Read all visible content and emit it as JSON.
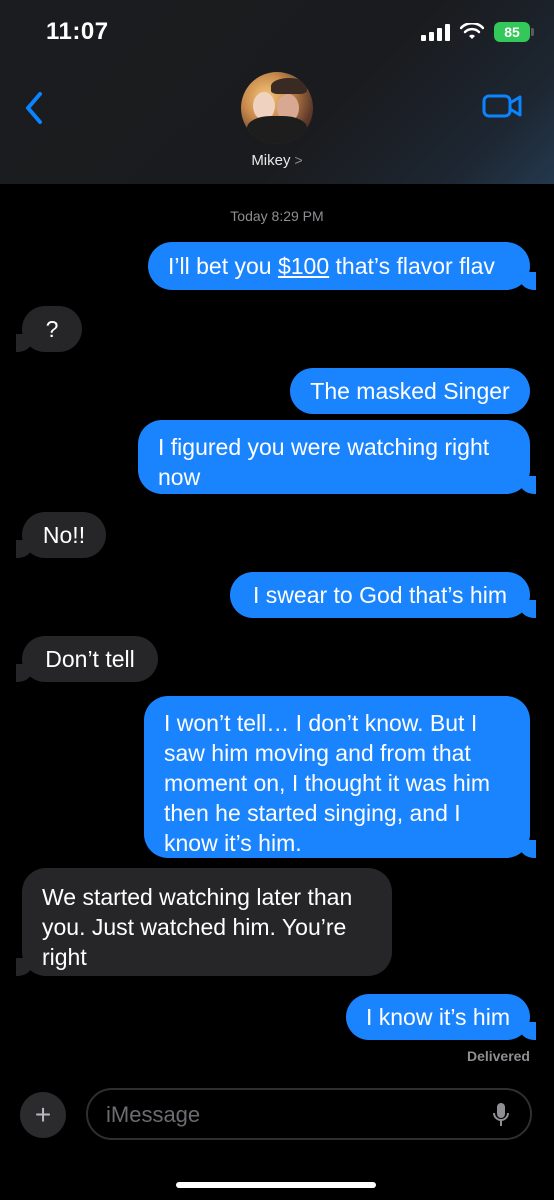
{
  "status_bar": {
    "time": "11:07",
    "battery": "85"
  },
  "header": {
    "contact_name": "Mikey",
    "chevron": ">"
  },
  "timestamp": "Today 8:29 PM",
  "messages": [
    {
      "type": "sent",
      "text_prefix": "I’ll bet you ",
      "link_text": "$100",
      "text_suffix": " that’s flavor flav"
    },
    {
      "type": "received",
      "text": "?"
    },
    {
      "type": "sent",
      "text": "The masked Singer"
    },
    {
      "type": "sent",
      "text": "I figured you were watching right now"
    },
    {
      "type": "received",
      "text": "No!!"
    },
    {
      "type": "sent",
      "text": "I swear to God that’s him"
    },
    {
      "type": "received",
      "text": "Don’t tell"
    },
    {
      "type": "sent",
      "text": "I won’t tell… I don’t know. But I saw him moving and from that moment on, I thought it was him then he started singing, and I know it’s him."
    },
    {
      "type": "received",
      "text": "We started watching later than you. Just watched him. You’re right"
    },
    {
      "type": "sent",
      "text": "I know it’s him"
    }
  ],
  "delivered_label": "Delivered",
  "composer": {
    "add_label": "+",
    "placeholder": "iMessage"
  },
  "colors": {
    "sent_bubble": "#1a84ff",
    "received_bubble": "#262628",
    "accent": "#0a84ff",
    "battery": "#34c759"
  },
  "icons": {
    "back": "chevron-left-icon",
    "video": "video-camera-icon",
    "mic": "microphone-icon",
    "wifi": "wifi-icon",
    "signal": "signal-icon"
  }
}
